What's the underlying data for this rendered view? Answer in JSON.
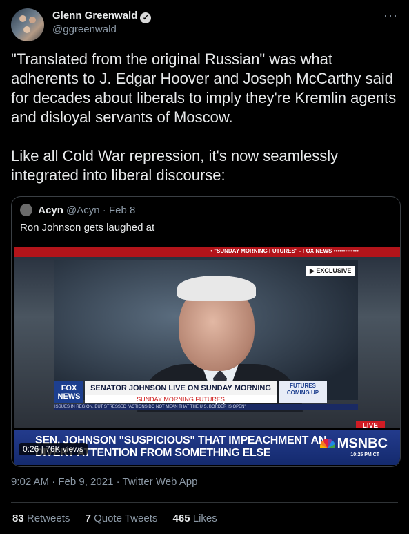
{
  "author": {
    "name": "Glenn Greenwald",
    "handle": "@ggreenwald",
    "verified": "✓"
  },
  "more_menu": "···",
  "tweet": {
    "paragraph1": "\"Translated from the original Russian\" was what adherents to J. Edgar Hoover and Joseph McCarthy said for decades about liberals to imply they're Kremlin agents and disloyal servants of Moscow.",
    "paragraph2": "Like all Cold War repression, it's now seamlessly integrated into liberal discourse:"
  },
  "quoted": {
    "name": "Acyn",
    "handle": "@Acyn",
    "date": "· Feb 8",
    "text": "Ron Johnson gets laughed at"
  },
  "video": {
    "top_banner": "• \"SUNDAY MORNING FUTURES\" - FOX NEWS •••••••••••••",
    "exclusive": "▶ EXCLUSIVE",
    "fox_logo": "FOX NEWS",
    "chyron": "SENATOR JOHNSON LIVE ON SUNDAY MORNING FUTURES",
    "chyron_sub": "SUNDAY MORNING FUTURES",
    "futures_badge": "FUTURES COMING UP",
    "ticker": "ISSUES IN REGION, BUT STRESSED \"ACTIONS DO NOT MEAN THAT THE U.S. BORDER IS OPEN\"",
    "live": "LIVE",
    "headline1": "SEN. JOHNSON \"SUSPICIOUS\" THAT IMPEACHMENT AN",
    "headline2": "DIVERT ATTENTION FROM SOMETHING ELSE",
    "network": "MSNBC",
    "clock": "10:25 PM CT",
    "duration_views": "0:26 | 76K views"
  },
  "timestamp": "9:02 AM · Feb 9, 2021 · Twitter Web App",
  "stats": {
    "retweets_count": "83",
    "retweets_label": "Retweets",
    "quotes_count": "7",
    "quotes_label": "Quote Tweets",
    "likes_count": "465",
    "likes_label": "Likes"
  },
  "colors": {
    "background": "#000000",
    "text": "#e7e9ea",
    "muted": "#8b98a5",
    "border": "#3a3f44",
    "msnbc_blue": "#233b8c",
    "live_red": "#d11c24"
  }
}
